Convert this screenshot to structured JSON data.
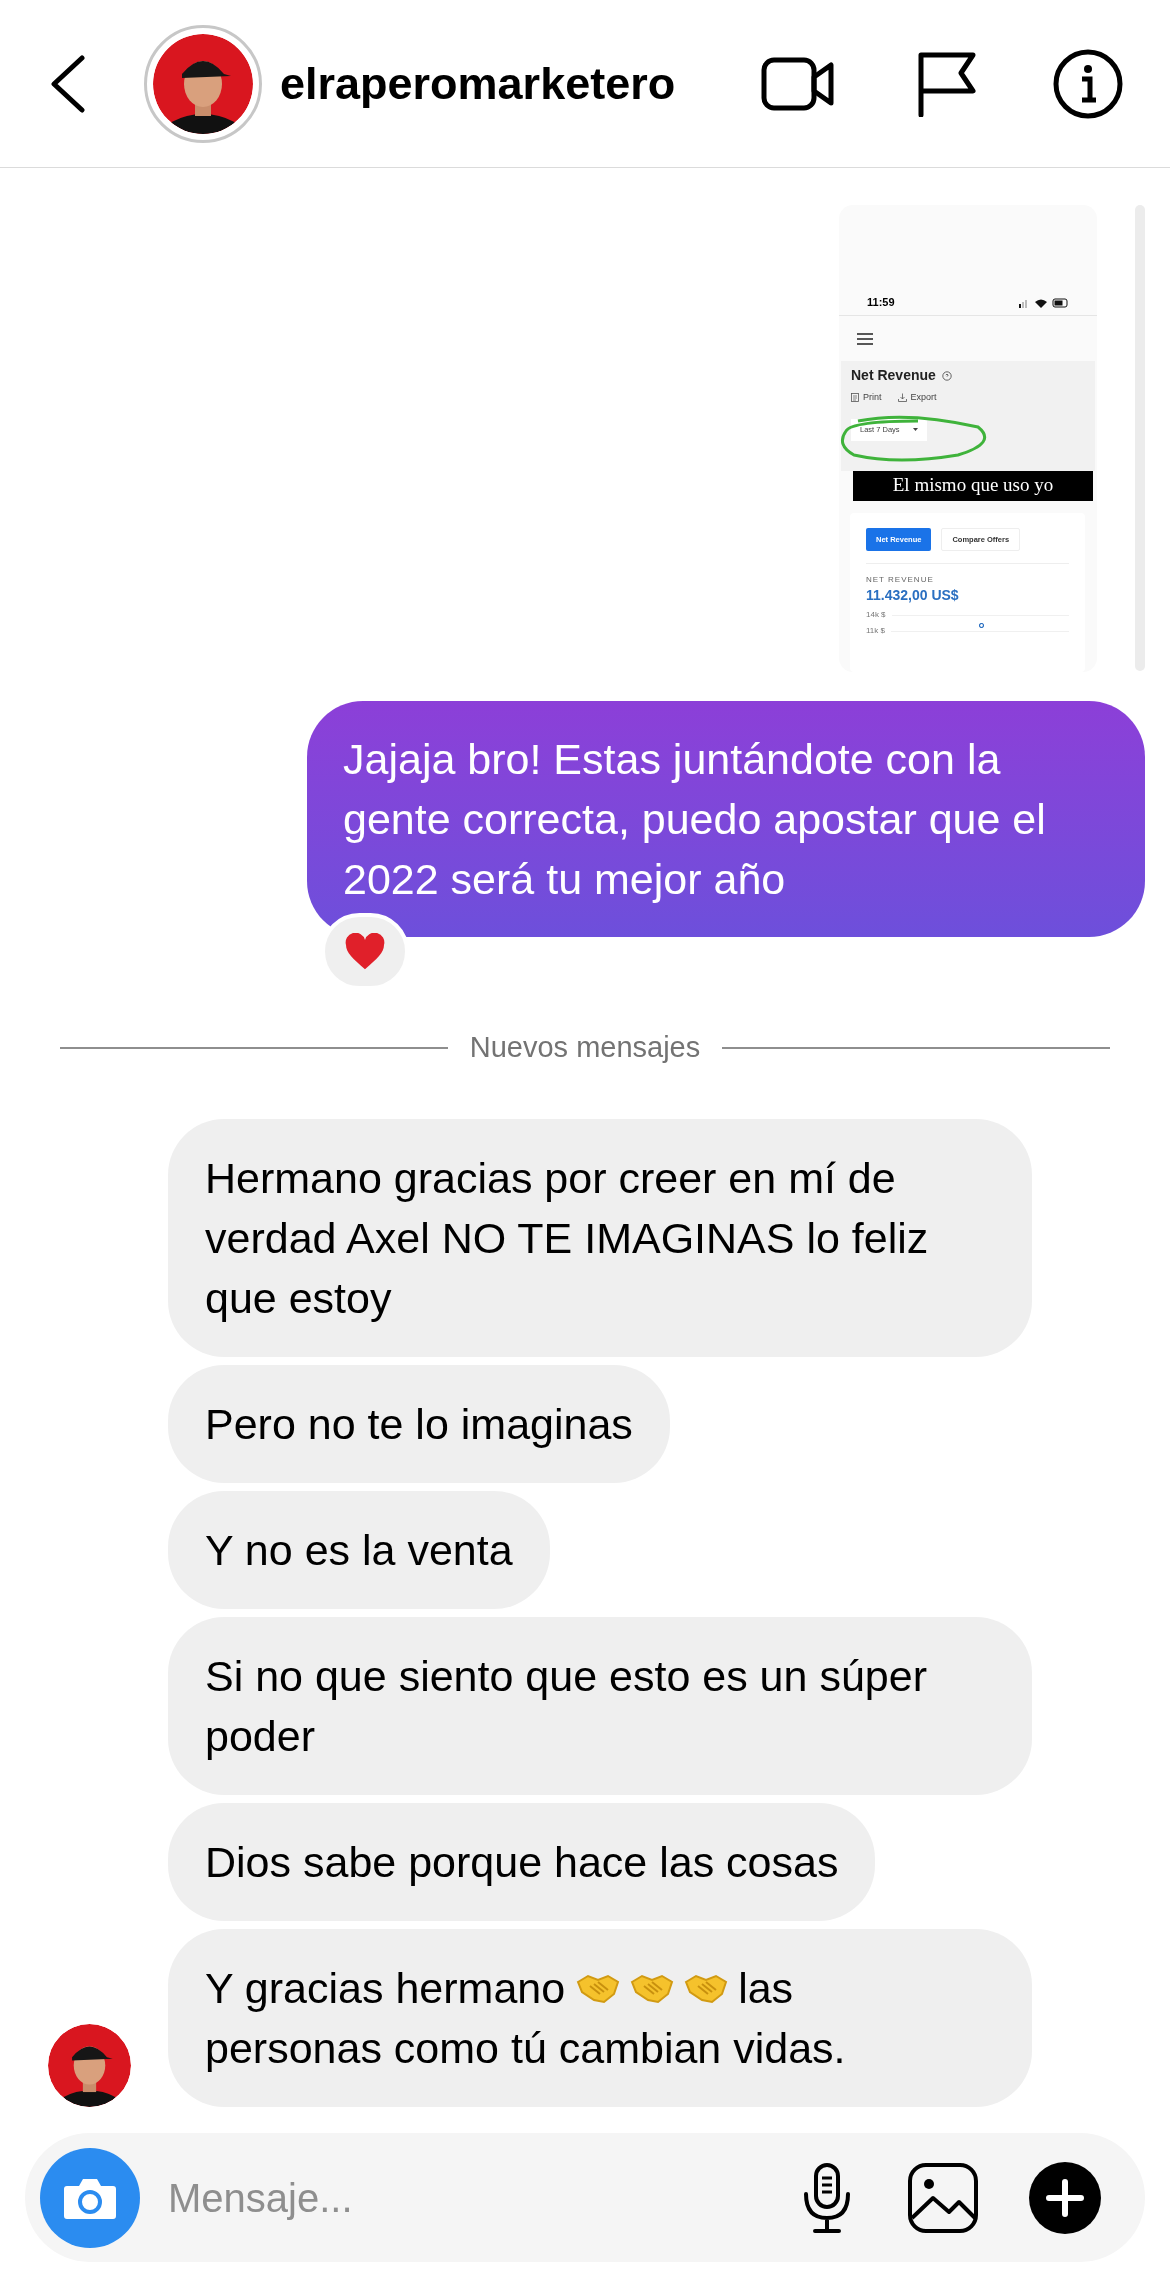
{
  "header": {
    "username": "elraperomarketero"
  },
  "shared_image": {
    "time": "11:59",
    "title": "Net Revenue",
    "actions": [
      "Print",
      "Export"
    ],
    "range": "Last 7 Days",
    "caption": "El mismo que uso yo",
    "tabs": [
      {
        "label": "Net Revenue",
        "selected": true
      },
      {
        "label": "Compare Offers",
        "selected": false
      }
    ],
    "metric_label": "NET REVENUE",
    "metric_value": "11.432,00 US$",
    "axis_ticks": [
      "14k $",
      "11k $"
    ]
  },
  "sent_message": {
    "text": "Jajaja bro! Estas juntándote con la gente correcta, puedo apostar que el 2022 será tu mejor año",
    "reaction": {
      "kind": "heart"
    }
  },
  "divider": "Nuevos mensajes",
  "received_messages": [
    {
      "parts": [
        {
          "kind": "text",
          "text": "Hermano gracias por creer en mí de verdad Axel NO TE IMAGINAS lo feliz que estoy"
        }
      ]
    },
    {
      "parts": [
        {
          "kind": "text",
          "text": "Pero no te lo imaginas"
        }
      ]
    },
    {
      "parts": [
        {
          "kind": "text",
          "text": "Y no es la venta"
        }
      ]
    },
    {
      "parts": [
        {
          "kind": "text",
          "text": "Si no que siento que esto es un súper poder"
        }
      ]
    },
    {
      "parts": [
        {
          "kind": "text",
          "text": "Dios sabe porque hace las cosas"
        }
      ]
    },
    {
      "parts": [
        {
          "kind": "text",
          "text": "Y gracias hermano"
        },
        {
          "kind": "handshake"
        },
        {
          "kind": "handshake"
        },
        {
          "kind": "handshake"
        },
        {
          "kind": "text",
          "text": "las"
        },
        {
          "kind": "text",
          "text": "personas como tú cambian vidas."
        }
      ]
    }
  ],
  "composer": {
    "placeholder": "Mensaje..."
  }
}
